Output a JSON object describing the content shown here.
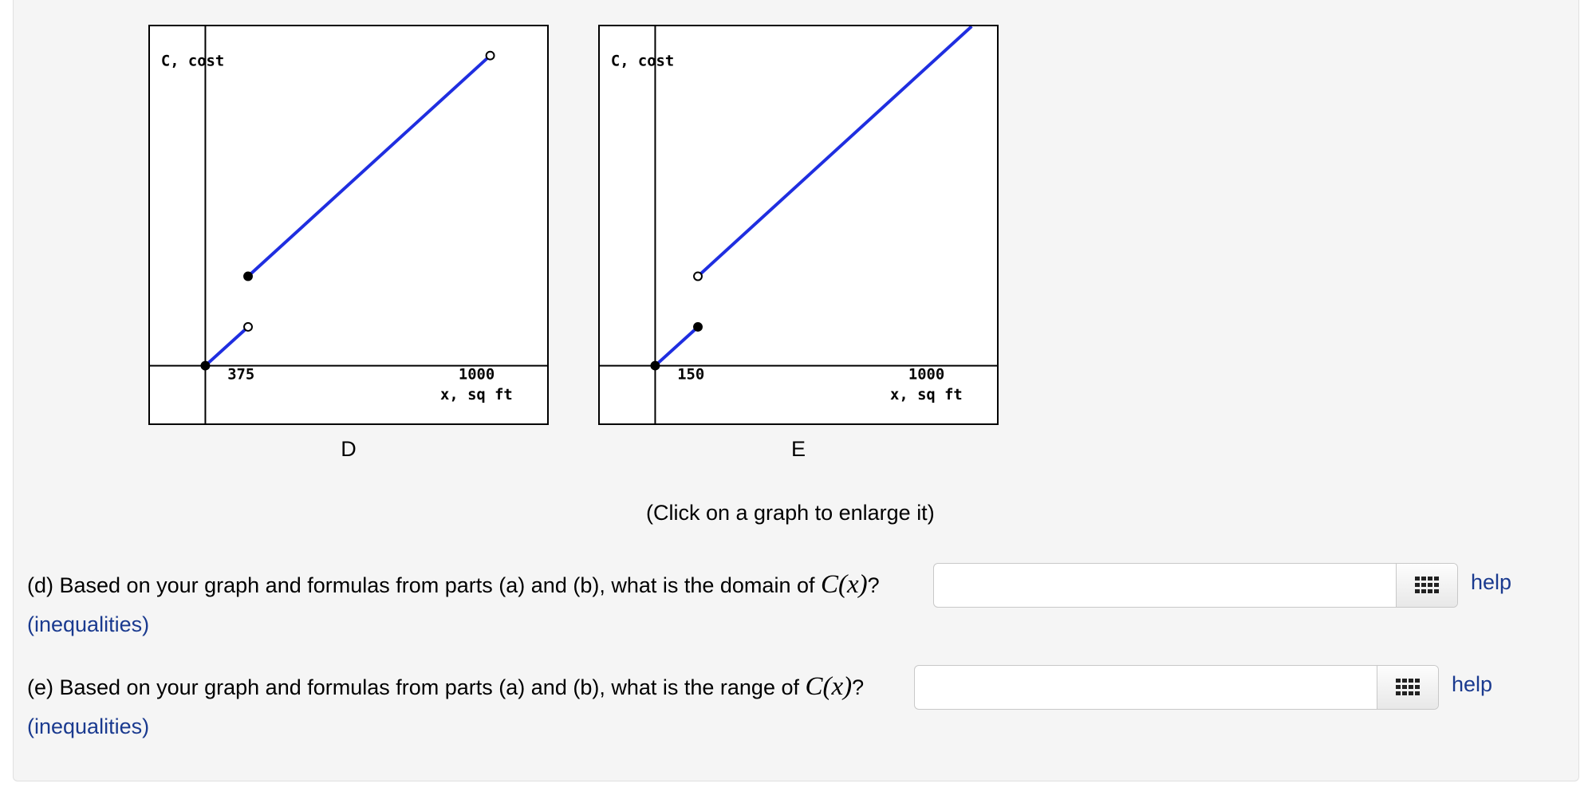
{
  "graphs": [
    {
      "letter": "D",
      "ylabel": "C, cost",
      "xlabel": "x, sq ft",
      "tick_mid": "375",
      "tick_right": "1000",
      "line_color": "#1f2ee0",
      "segments": [
        {
          "from": "closed",
          "to": "open"
        },
        {
          "from": "closed",
          "to": "open"
        }
      ]
    },
    {
      "letter": "E",
      "ylabel": "C, cost",
      "xlabel": "x, sq ft",
      "tick_mid": "150",
      "tick_right": "1000",
      "line_color": "#1f2ee0",
      "segments": [
        {
          "from": "closed",
          "to": "closed"
        },
        {
          "from": "open",
          "to": "continues"
        }
      ]
    }
  ],
  "hint": "(Click on a graph to enlarge it)",
  "questions": {
    "d": {
      "prefix": "(d) Based on your graph and formulas from parts (a) and (b), what is the domain of ",
      "math": "C(x)",
      "suffix": "?",
      "help": "help",
      "help_sub": "(inequalities)",
      "value": ""
    },
    "e": {
      "prefix": "(e) Based on your graph and formulas from parts (a) and (b), what is the range of ",
      "math": "C(x)",
      "suffix": "?",
      "help": "help",
      "help_sub": "(inequalities)",
      "value": ""
    }
  },
  "colors": {
    "panel_bg": "#f5f5f5",
    "link": "#1a3a8f",
    "plot_line": "#1f2ee0"
  },
  "icons": {
    "keyboard": "keyboard-grid-icon"
  }
}
